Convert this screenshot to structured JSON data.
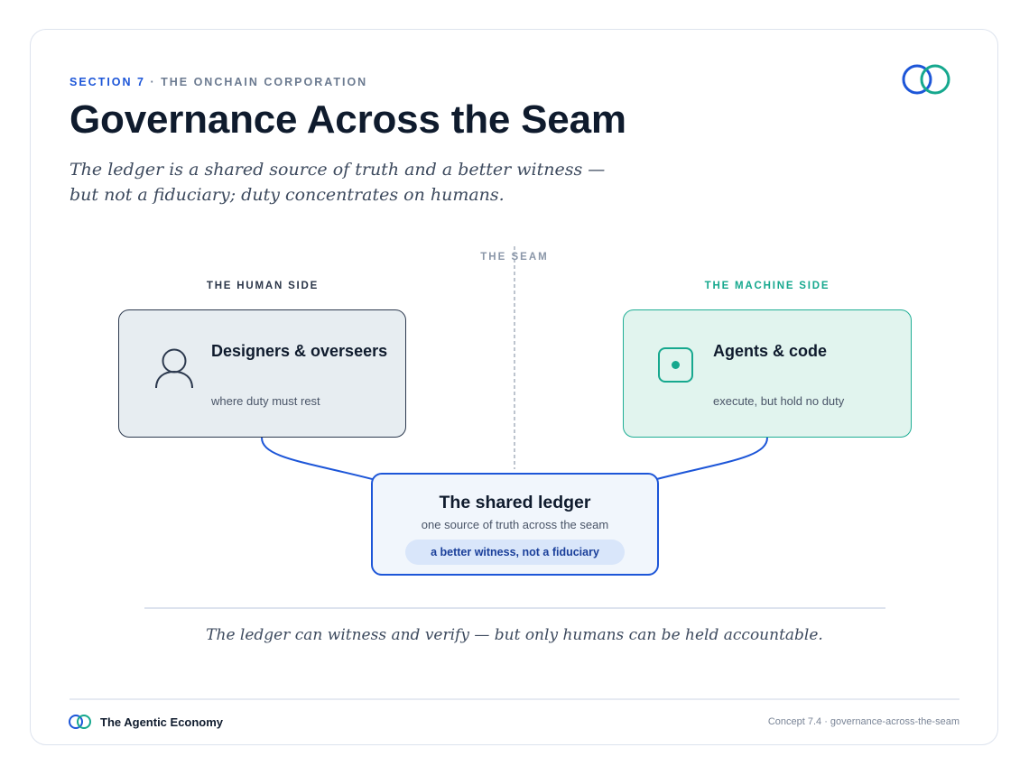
{
  "header": {
    "section_label": "SECTION 7",
    "section_separator": " · ",
    "section_name": "THE ONCHAIN CORPORATION",
    "title": "Governance Across the Seam",
    "subtitle": "The ledger is a shared source of truth and a better witness — but not a fiduciary; duty concentrates on humans."
  },
  "diagram": {
    "seam_label": "THE SEAM",
    "human": {
      "side_label": "THE HUMAN SIDE",
      "title": "Designers & overseers",
      "subtitle": "where duty must rest",
      "icon": "person-icon"
    },
    "machine": {
      "side_label": "THE MACHINE SIDE",
      "title": "Agents & code",
      "subtitle": "execute, but hold no duty",
      "icon": "chip-icon"
    },
    "ledger": {
      "title": "The shared ledger",
      "subtitle": "one source of truth across the seam",
      "pill": "a better witness, not a fiduciary"
    }
  },
  "quote": "The ledger can witness and verify — but only humans can be held accountable.",
  "footer": {
    "brand": "The Agentic Economy",
    "meta": "Concept 7.4 · governance-across-the-seam"
  },
  "colors": {
    "accent_blue": "#1d56d8",
    "accent_teal": "#16a88e",
    "ink": "#0f1b2d",
    "muted": "#6b7a90"
  }
}
